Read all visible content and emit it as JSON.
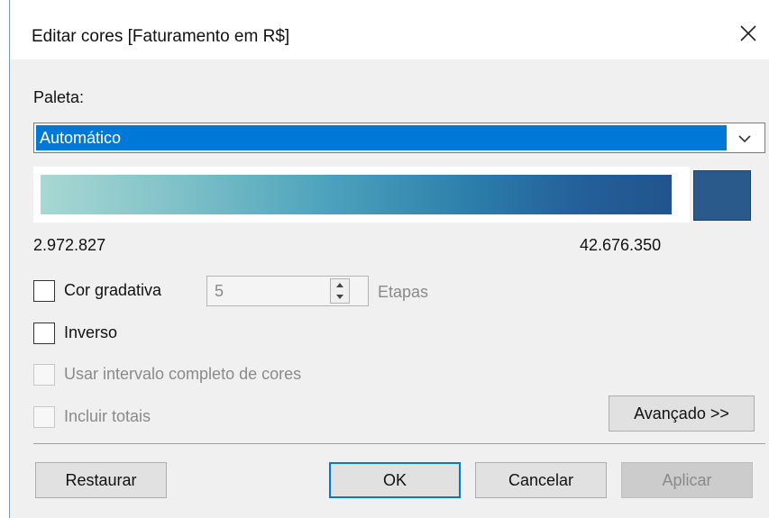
{
  "dialog": {
    "title": "Editar cores [Faturamento em R$]",
    "close_icon": "close-icon"
  },
  "palette": {
    "label": "Paleta:",
    "selected": "Automático",
    "dropdown_icon": "chevron-down-icon",
    "gradient_start_color": "#a8d8d3",
    "gradient_end_color": "#21548c",
    "swatch_color": "#2a5a8c",
    "min_value": "2.972.827",
    "max_value": "42.676.350"
  },
  "options": {
    "stepped": {
      "label": "Cor gradativa",
      "checked": false,
      "steps_value": "5",
      "steps_label": "Etapas"
    },
    "reversed": {
      "label": "Inverso",
      "checked": false
    },
    "full_range": {
      "label": "Usar intervalo completo de cores",
      "checked": false,
      "enabled": false
    },
    "include_totals": {
      "label": "Incluir totais",
      "checked": false,
      "enabled": false
    }
  },
  "buttons": {
    "advanced": "Avançado >>",
    "reset": "Restaurar",
    "ok": "OK",
    "cancel": "Cancelar",
    "apply": "Aplicar"
  }
}
